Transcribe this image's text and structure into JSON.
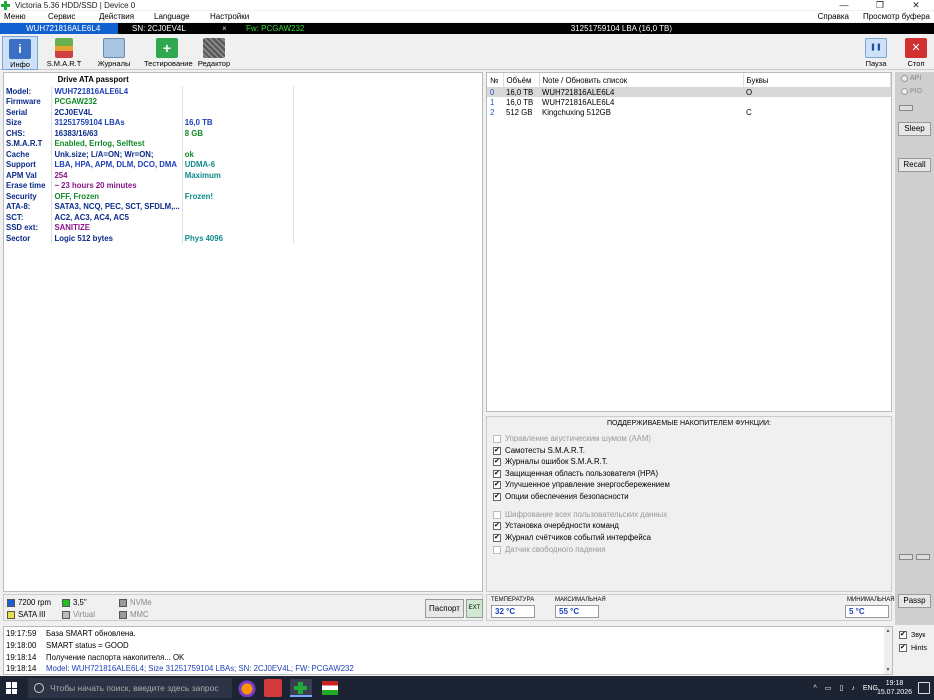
{
  "window": {
    "title": "Victoria 5.36 HDD/SSD | Device 0",
    "controls": {
      "minimize": "—",
      "restore": "❐",
      "close": "✕"
    }
  },
  "menu": {
    "items": [
      "Меню",
      "Сервис",
      "Действия",
      "Language",
      "Настройки"
    ],
    "right": [
      "Справка",
      "Просмотр буфера"
    ]
  },
  "device_bar": {
    "model": "WUH721816ALE6L4",
    "sn": "SN: 2CJ0EV4L",
    "close": "×",
    "fw": "Fw: PCGAW232",
    "lba": "31251759104 LBA (16,0 TB)"
  },
  "toolbar": {
    "info": "Инфо",
    "smart": "S.M.A.R.T",
    "logs": "Журналы",
    "test": "Тестирование",
    "editor": "Редактор",
    "pause": "Пауза",
    "stop": "Стоп"
  },
  "passport": {
    "header": "Drive ATA passport",
    "rows": [
      {
        "k": "Model:",
        "v": "WUH721816ALE6L4",
        "v2": ""
      },
      {
        "k": "Firmware",
        "v": "PCGAW232",
        "v2": ""
      },
      {
        "k": "Serial",
        "v": "2CJ0EV4L",
        "v2": ""
      },
      {
        "k": "Size",
        "v": "31251759104 LBAs",
        "v2": "16,0 TB"
      },
      {
        "k": "CHS:",
        "v": "16383/16/63",
        "v2": "8 GB"
      },
      {
        "k": "S.M.A.R.T",
        "v": "Enabled, Errlog, Selftest",
        "v2": ""
      },
      {
        "k": "Cache",
        "v": "Unk.size; L/A=ON; Wr=ON;",
        "v2": "ok"
      },
      {
        "k": "Support",
        "v": "LBA, HPA, APM, DLM, DCO, DMA",
        "v2": "UDMA-6"
      },
      {
        "k": "APM Val",
        "v": "254",
        "v2": "Maximum"
      },
      {
        "k": "Erase time",
        "v": "~ 23 hours 20 minutes",
        "v2": ""
      },
      {
        "k": "Security",
        "v": "OFF, Frozen",
        "v2": "Frozen!"
      },
      {
        "k": "ATA-8:",
        "v": "SATA3, NCQ, PEC, SCT, SFDLM,...",
        "v2": ""
      },
      {
        "k": "SCT:",
        "v": "AC2, AC3, AC4, AC5",
        "v2": ""
      },
      {
        "k": "SSD ext:",
        "v": "SANITIZE",
        "v2": ""
      },
      {
        "k": "Sector",
        "v": "Logic 512 bytes",
        "v2": "Phys 4096"
      }
    ]
  },
  "drives": {
    "columns": [
      "№",
      "Объём",
      "Note / Обновить список",
      "Буквы"
    ],
    "rows": [
      {
        "n": "0",
        "size": "16,0 TB",
        "note": "WUH721816ALE6L4",
        "letters": "O"
      },
      {
        "n": "1",
        "size": "16,0 TB",
        "note": "WUH721816ALE6L4",
        "letters": ""
      },
      {
        "n": "2",
        "size": "512 GB",
        "note": "Kingchuxing 512GB",
        "letters": "C"
      }
    ]
  },
  "features": {
    "title": "ПОДДЕРЖИВАЕМЫЕ НАКОПИТЕЛЕМ ФУНКЦИИ:",
    "items": [
      {
        "label": "Управление акустическим шумом (AAM)",
        "checked": false,
        "enabled": false
      },
      {
        "label": "Самотесты S.M.A.R.T.",
        "checked": true,
        "enabled": true
      },
      {
        "label": "Журналы ошибок S.M.A.R.T.",
        "checked": true,
        "enabled": true
      },
      {
        "label": "Защищенная область пользователя (HPA)",
        "checked": true,
        "enabled": true
      },
      {
        "label": "Улучшенное управление энергосбережением",
        "checked": true,
        "enabled": true
      },
      {
        "label": "Опции обеспечения безопасности",
        "checked": true,
        "enabled": true
      },
      {
        "label": "Шифрование всех пользовательских данных",
        "checked": false,
        "enabled": false
      },
      {
        "label": "Установка очерёдности команд",
        "checked": true,
        "enabled": true
      },
      {
        "label": "Журнал счётчиков событий интерфейса",
        "checked": true,
        "enabled": true
      },
      {
        "label": "Датчик свободного падения",
        "checked": false,
        "enabled": false
      }
    ]
  },
  "side": {
    "api": "API",
    "pio": "PIO",
    "sleep": "Sleep",
    "recall": "Recall",
    "passp": "Passp"
  },
  "legend": {
    "rpm": "7200 rpm",
    "form": "3,5\"",
    "nvme": "NVMe",
    "sata": "SATA III",
    "virtual": "Virtual",
    "mmc": "MMC",
    "passport_btn": "Паспорт",
    "ext_btn": "EXT"
  },
  "temps": {
    "temp_label": "ТЕМПЕРАТУРА",
    "temp": "32 °C",
    "max_label": "МАКСИМАЛЬНАЯ",
    "max": "55 °C",
    "min_label": "МИНИМАЛЬНАЯ",
    "min": "5 °C"
  },
  "log": [
    {
      "t": "19:17:59",
      "m": "База SMART обновлена.",
      "blue": false
    },
    {
      "t": "19:18:00",
      "m": "SMART status = GOOD",
      "blue": false
    },
    {
      "t": "19:18:14",
      "m": "Получение паспорта накопителя... OK",
      "blue": false
    },
    {
      "t": "19:18:14",
      "m": "Model: WUH721816ALE6L4; Size 31251759104 LBAs; SN: 2CJ0EV4L; FW: PCGAW232",
      "blue": true
    }
  ],
  "log_checks": {
    "sound": "Звук",
    "hints": "Hints"
  },
  "taskbar": {
    "search": "Чтобы начать поиск, введите здесь запрос",
    "lang": "ENG",
    "time": "19:18",
    "date": "15.07.2026"
  },
  "colors": {
    "accent": "#1060d0",
    "green": "#0f8a2a",
    "purple": "#8a148a"
  }
}
